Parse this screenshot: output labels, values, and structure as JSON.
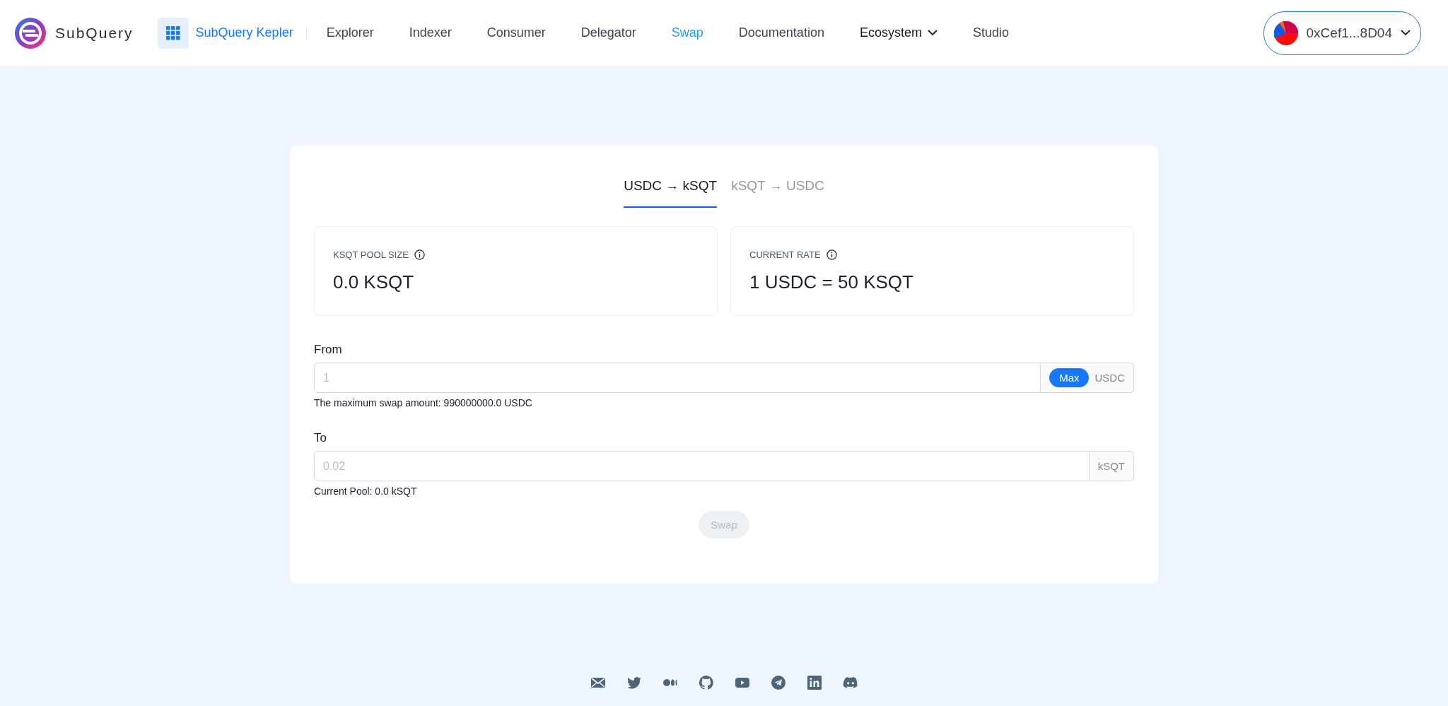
{
  "header": {
    "logo_text": "SubQuery",
    "app_name": "SubQuery Kepler",
    "nav": [
      {
        "label": "Explorer",
        "selected": false,
        "dropdown": false
      },
      {
        "label": "Indexer",
        "selected": false,
        "dropdown": false
      },
      {
        "label": "Consumer",
        "selected": false,
        "dropdown": false
      },
      {
        "label": "Delegator",
        "selected": false,
        "dropdown": false
      },
      {
        "label": "Swap",
        "selected": true,
        "dropdown": false
      },
      {
        "label": "Documentation",
        "selected": false,
        "dropdown": false
      },
      {
        "label": "Ecosystem",
        "selected": false,
        "dropdown": true
      },
      {
        "label": "Studio",
        "selected": false,
        "dropdown": false
      }
    ],
    "wallet": "0xCef1...8D04"
  },
  "swap": {
    "tabs": [
      {
        "label": "USDC → kSQT",
        "selected": true
      },
      {
        "label": "kSQT → USDC",
        "selected": false
      }
    ],
    "stats": [
      {
        "label": "KSQT POOL SIZE",
        "value": "0.0 KSQT"
      },
      {
        "label": "CURRENT RATE",
        "value": "1 USDC = 50 KSQT"
      }
    ],
    "from": {
      "label": "From",
      "placeholder": "1",
      "max_button": "Max",
      "unit": "USDC",
      "hint": "The maximum swap amount: 990000000.0 USDC"
    },
    "to": {
      "label": "To",
      "placeholder": "0.02",
      "unit": "kSQT",
      "hint": "Current Pool: 0.0 kSQT"
    },
    "button": {
      "label": "Swap",
      "disabled": true
    }
  }
}
